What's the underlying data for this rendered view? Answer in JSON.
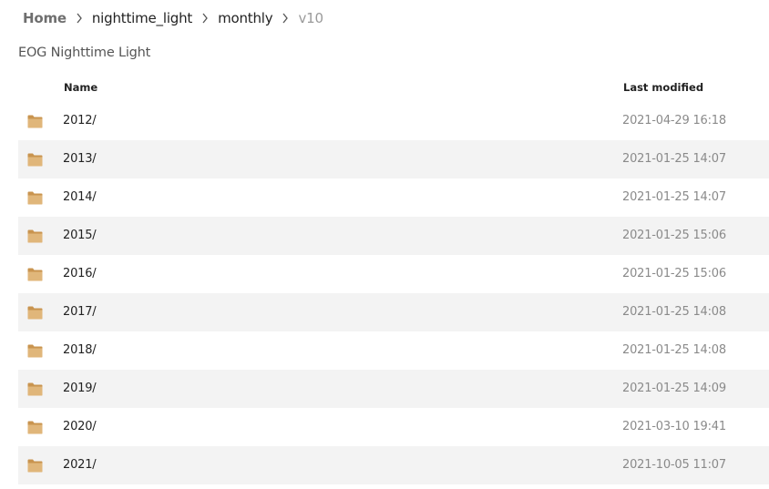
{
  "breadcrumb": {
    "home": "Home",
    "level1": "nighttime_light",
    "level2": "monthly",
    "current": "v10"
  },
  "page_title": "EOG Nighttime Light",
  "columns": {
    "name": "Name",
    "modified": "Last modified"
  },
  "rows": [
    {
      "name": "2012/",
      "modified": "2021-04-29 16:18"
    },
    {
      "name": "2013/",
      "modified": "2021-01-25 14:07"
    },
    {
      "name": "2014/",
      "modified": "2021-01-25 14:07"
    },
    {
      "name": "2015/",
      "modified": "2021-01-25 15:06"
    },
    {
      "name": "2016/",
      "modified": "2021-01-25 15:06"
    },
    {
      "name": "2017/",
      "modified": "2021-01-25 14:08"
    },
    {
      "name": "2018/",
      "modified": "2021-01-25 14:08"
    },
    {
      "name": "2019/",
      "modified": "2021-01-25 14:09"
    },
    {
      "name": "2020/",
      "modified": "2021-03-10 19:41"
    },
    {
      "name": "2021/",
      "modified": "2021-10-05 11:07"
    }
  ],
  "icons": {
    "folder": "folder-icon",
    "separator": "chevron-right-icon"
  },
  "colors": {
    "folder_fill": "#d9a86b",
    "row_alt": "#f3f3f3"
  }
}
